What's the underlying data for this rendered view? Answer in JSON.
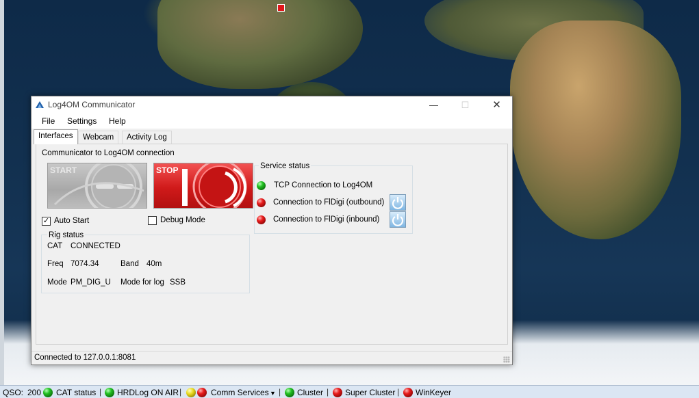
{
  "window": {
    "title": "Log4OM Communicator",
    "minimize_glyph": "—",
    "maximize_glyph": "☐",
    "close_glyph": "✕"
  },
  "menu": [
    "File",
    "Settings",
    "Help"
  ],
  "tabs": [
    {
      "label": "Interfaces",
      "active": true
    },
    {
      "label": "Webcam",
      "active": false
    },
    {
      "label": "Activity Log",
      "active": false
    }
  ],
  "connection": {
    "title": "Communicator to Log4OM connection",
    "start_label": "START",
    "stop_label": "STOP",
    "auto_start_label": "Auto Start",
    "auto_start_checked": true,
    "debug_mode_label": "Debug Mode",
    "debug_mode_checked": false
  },
  "rig": {
    "title": "Rig status",
    "cat_label": "CAT",
    "cat_value": "CONNECTED",
    "freq_label": "Freq",
    "freq_value": "7074.34",
    "band_label": "Band",
    "band_value": "40m",
    "mode_label": "Mode",
    "mode_value": "PM_DIG_U",
    "mode_for_log_label": "Mode for log",
    "mode_for_log_value": "SSB"
  },
  "service": {
    "title": "Service status",
    "items": [
      {
        "label": "TCP Connection to Log4OM",
        "status": "green",
        "has_button": false
      },
      {
        "label": "Connection to FlDigi (outbound)",
        "status": "red",
        "has_button": true
      },
      {
        "label": "Connection to FlDigi (inbound)",
        "status": "red",
        "has_button": true
      }
    ]
  },
  "statusbar": {
    "text": "Connected to 127.0.0.1:8081"
  },
  "app_status": {
    "qso_label": "QSO:",
    "qso_count": "200",
    "cat_status": "CAT status",
    "hrdlog": "HRDLog ON AIR",
    "comm_services": "Comm Services",
    "cluster": "Cluster",
    "super_cluster": "Super Cluster",
    "winkeyer": "WinKeyer",
    "separator": "|"
  },
  "colors": {
    "led_green": "#22c022",
    "led_red": "#e81c1c",
    "stop_red": "#d01a1a",
    "status_bar_bg": "#dbe6f3"
  }
}
